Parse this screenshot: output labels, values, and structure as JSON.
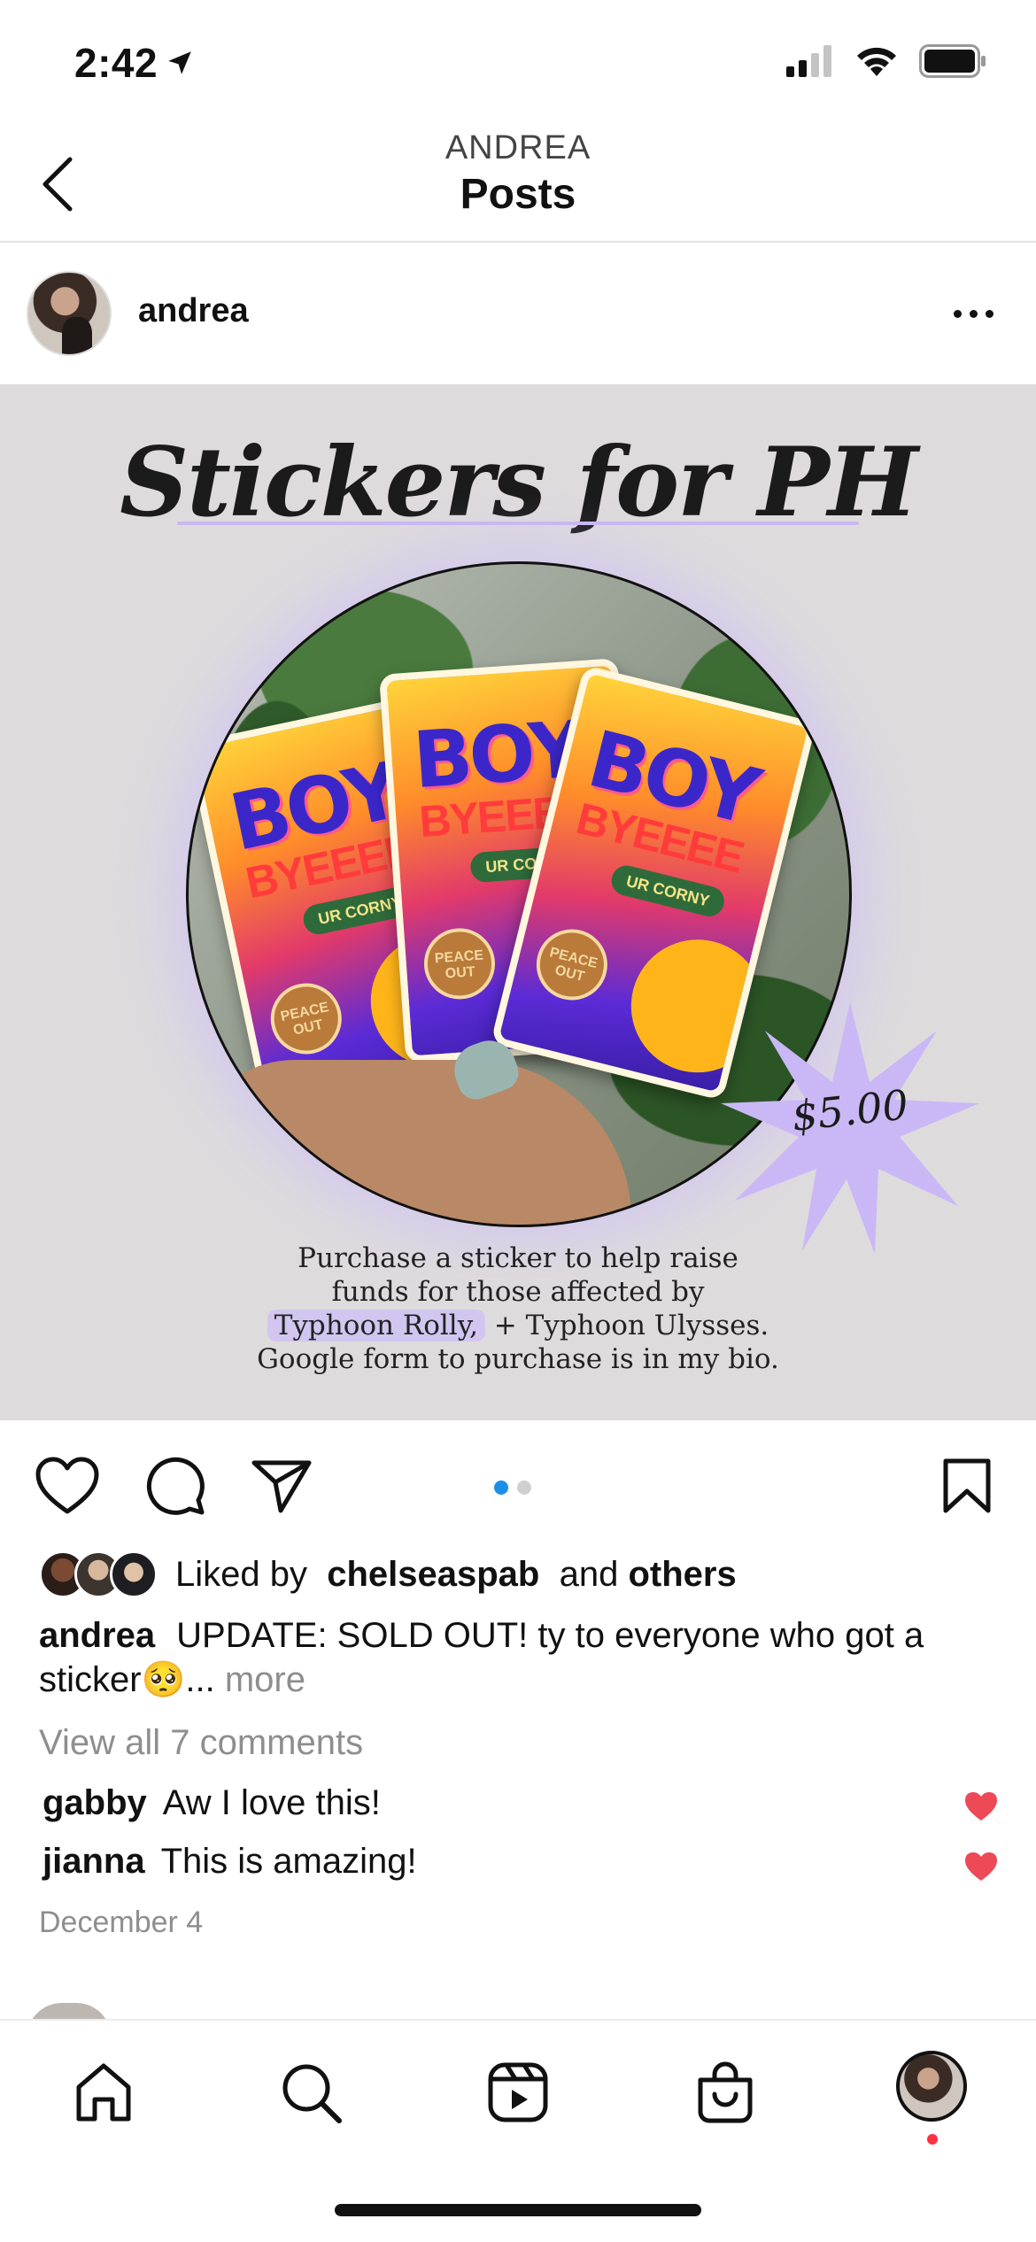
{
  "status_bar": {
    "time": "2:42"
  },
  "header": {
    "subtitle": "ANDREA",
    "title": "Posts"
  },
  "post": {
    "username": "andrea",
    "image": {
      "title": "Stickers for PH",
      "price": "$5.00",
      "sticker_text_1": "BOY",
      "sticker_text_2": "BYEEEE",
      "sticker_pill": "UR CORNY",
      "sticker_badge": "PEACE OUT",
      "description_line1": "Purchase a sticker to help raise",
      "description_line2": "funds for those affected by",
      "description_line3a": "Typhoon Rolly,",
      "description_line3b": " + Typhoon Ulysses.",
      "description_line4": "Google form to purchase is in my bio."
    },
    "carousel": {
      "count": 2,
      "active_index": 0
    },
    "likes": {
      "prefix": "Liked by",
      "user": "chelseaspab",
      "and": "and",
      "others": "others"
    },
    "caption": {
      "username": "andrea",
      "text": "UPDATE: SOLD OUT! ty to everyone who got a sticker🥺",
      "ellipsis": "...",
      "more": "more"
    },
    "view_comments": "View all 7 comments",
    "comments": [
      {
        "username": "gabby",
        "text": "Aw I love this!"
      },
      {
        "username": "jianna",
        "text": "This is amazing!"
      }
    ],
    "date": "December 4"
  },
  "colors": {
    "accent_blue": "#1d8fe8",
    "like_red": "#ed4956",
    "lavender": "#c9b8f2"
  },
  "icons": {
    "back": "chevron-left-icon",
    "more": "more-horizontal-icon",
    "like": "heart-icon",
    "comment": "comment-icon",
    "share": "send-icon",
    "save": "bookmark-icon",
    "tabs": [
      "home-icon",
      "search-icon",
      "reels-icon",
      "shop-icon",
      "profile-avatar"
    ]
  }
}
